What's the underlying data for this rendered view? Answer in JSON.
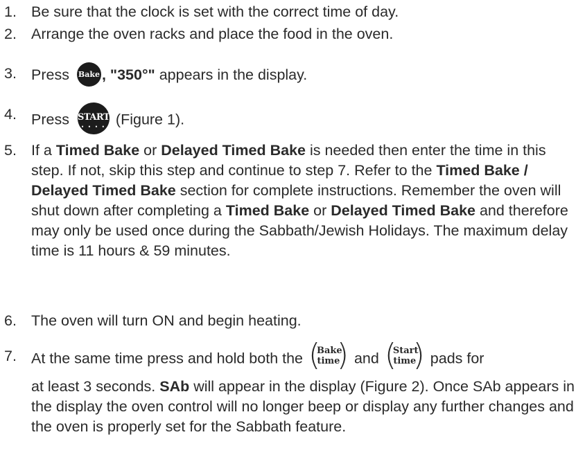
{
  "steps": [
    {
      "num": "1.",
      "text": "Be sure that the clock is set with the correct time of day."
    },
    {
      "num": "2.",
      "text": "Arrange the oven racks and place the food in the oven."
    },
    {
      "num": "3.",
      "pre": "Press ",
      "button": "Bake",
      "post_bold": ", \"350°\"",
      "post": " appears in the display."
    },
    {
      "num": "4.",
      "pre": "Press ",
      "button": "START",
      "post": " (Figure 1)."
    },
    {
      "num": "5.",
      "segments": [
        {
          "t": "If a ",
          "b": false
        },
        {
          "t": "Timed Bake",
          "b": true
        },
        {
          "t": " or ",
          "b": false
        },
        {
          "t": "Delayed Timed Bake",
          "b": true
        },
        {
          "t": " is needed then enter the time in this step. If not, skip this step and continue to step 7. Refer to the ",
          "b": false
        },
        {
          "t": "Timed Bake / Delayed Timed Bake",
          "b": true
        },
        {
          "t": " section for complete instructions. Remember the oven will shut down after completing a ",
          "b": false
        },
        {
          "t": "Timed Bake",
          "b": true
        },
        {
          "t": " or ",
          "b": false
        },
        {
          "t": "Delayed Timed Bake",
          "b": true
        },
        {
          "t": " and therefore may only be used once during the Sabbath/Jewish Holidays. The maximum delay time is 11 hours & 59 minutes.",
          "b": false
        }
      ]
    },
    {
      "num": "6.",
      "text": "The oven will turn ON and begin heating."
    },
    {
      "num": "7.",
      "line1_pre": "At the same time press and hold both the ",
      "pad1_top": "Bake",
      "pad1_bottom": "time",
      "line1_mid": " and ",
      "pad2_top": "Start",
      "pad2_bottom": "time",
      "line1_post": " pads for",
      "line2_pre": "at least 3 seconds. ",
      "line2_bold": "SAb",
      "line2_post": " will appear in the display (Figure 2). Once SAb appears in the display the oven control will no longer beep or display any further changes and the oven is properly set for the Sabbath feature."
    }
  ],
  "button_dots": "• • • •"
}
